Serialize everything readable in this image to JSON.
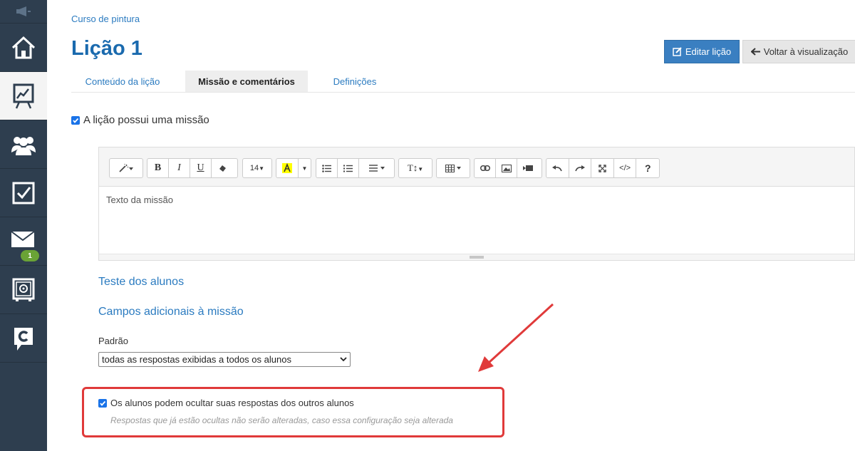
{
  "sidebar": {
    "items": [
      {
        "icon": "home-icon"
      },
      {
        "icon": "chart-board-icon",
        "active": true
      },
      {
        "icon": "users-icon"
      },
      {
        "icon": "checkbox-icon"
      },
      {
        "icon": "mail-icon",
        "badge": "1"
      },
      {
        "icon": "safe-icon"
      },
      {
        "icon": "c-logo-icon"
      }
    ]
  },
  "header": {
    "breadcrumb": "Curso de pintura",
    "title": "Lição 1",
    "edit_button": "Editar lição",
    "back_button": "Voltar à visualização"
  },
  "tabs": [
    {
      "label": "Conteúdo da lição"
    },
    {
      "label": "Missão e comentários",
      "active": true
    },
    {
      "label": "Definições"
    }
  ],
  "mission": {
    "checkbox_label": "A lição possui uma missão",
    "checked": true,
    "editor_placeholder": "Texto da missão",
    "font_size": "14"
  },
  "sections": {
    "tests_link": "Teste dos alunos",
    "fields_link": "Campos adicionais à missão",
    "default_label": "Padrão",
    "default_value": "todas as respostas exibidas a todos os alunos"
  },
  "hide_option": {
    "label": "Os alunos podem ocultar suas respostas dos outros alunos",
    "checked": true,
    "hint": "Respostas que já estão ocultas não serão alteradas, caso essa configuração seja alterada"
  },
  "colors": {
    "sidebar": "#2e3e4f",
    "accent": "#2b7bc0",
    "title": "#1a6aae",
    "highlight": "#e03a3a"
  }
}
